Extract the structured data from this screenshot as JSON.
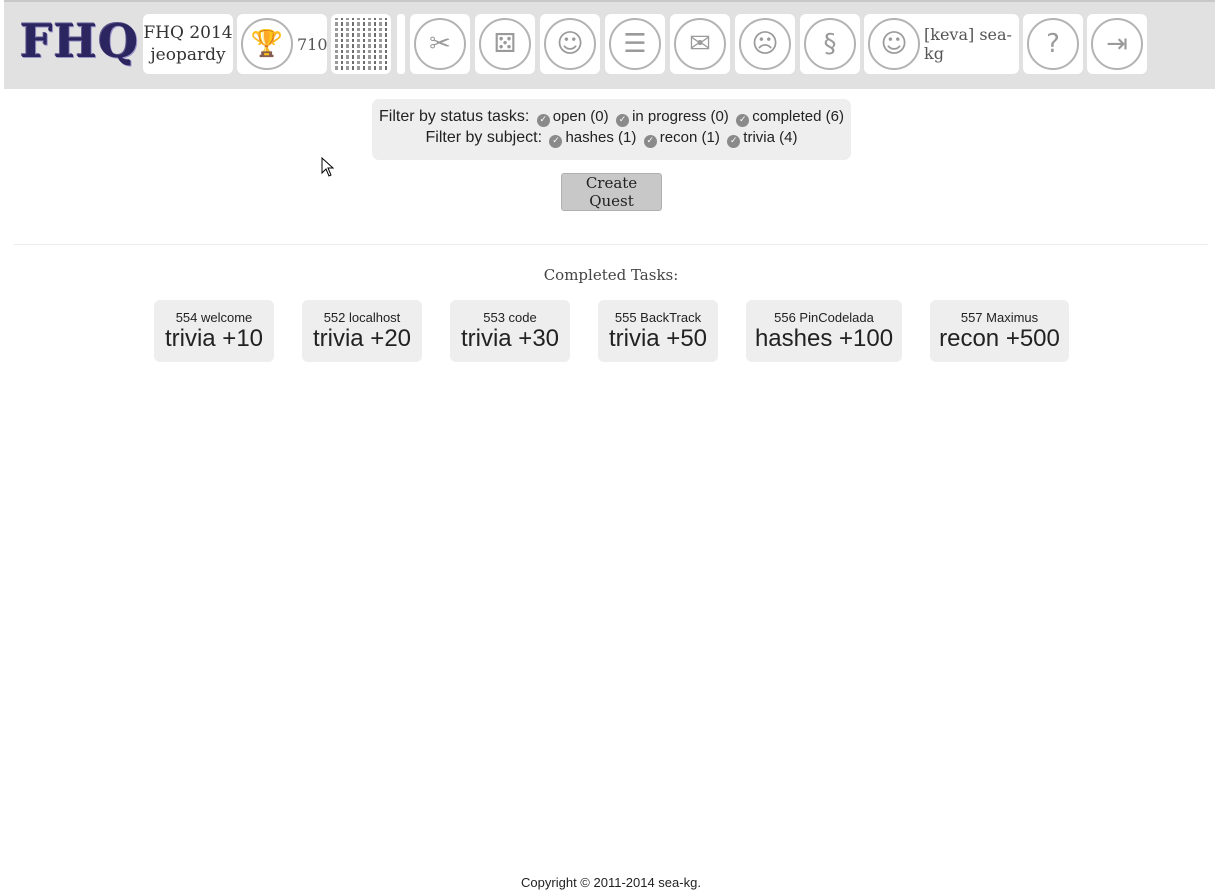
{
  "header": {
    "logo": "FHQ",
    "game_line1": "FHQ 2014",
    "game_line2": "jeopardy",
    "score": "710",
    "user_label": "[keva] sea-kg",
    "icons": [
      "trophy-icon",
      "qr-code-icon",
      "tools-icon",
      "dice-icon",
      "user-feedback-icon",
      "news-icon",
      "mailbox-icon",
      "person-icon",
      "scroll-icon",
      "user-profile-icon",
      "help-icon",
      "exit-icon"
    ]
  },
  "filter": {
    "status_label": "Filter by status tasks:",
    "status_options": [
      "open (0)",
      "in progress (0)",
      "completed (6)"
    ],
    "subject_label": "Filter by subject:",
    "subject_options": [
      "hashes (1)",
      "recon (1)",
      "trivia (4)"
    ]
  },
  "create_button": "Create Quest",
  "completed_title": "Completed Tasks:",
  "tasks": [
    {
      "name": "554 welcome",
      "points": "trivia +10"
    },
    {
      "name": "552 localhost",
      "points": "trivia +20"
    },
    {
      "name": "553 code",
      "points": "trivia +30"
    },
    {
      "name": "555 BackTrack",
      "points": "trivia +50"
    },
    {
      "name": "556 PinCodelada",
      "points": "hashes +100"
    },
    {
      "name": "557 Maximus",
      "points": "recon +500"
    }
  ],
  "footer": "Copyright © 2011-2014 sea-kg.",
  "colors": {
    "header_bg": "#e1e1e1",
    "panel_bg": "#eeeeee",
    "logo": "#2b2560",
    "button_bg": "#c8c8c8"
  }
}
